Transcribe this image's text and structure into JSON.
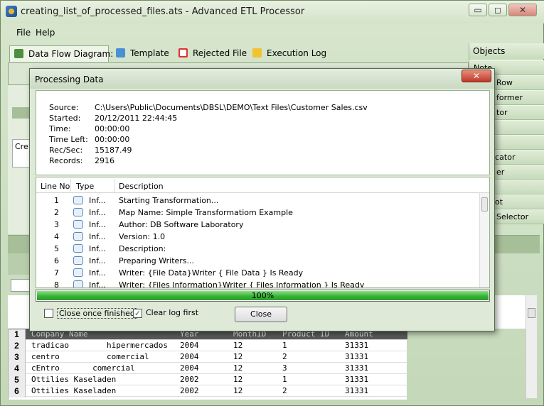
{
  "window": {
    "title": "creating_list_of_processed_files.ats - Advanced ETL Processor",
    "minimize_glyph": "▭",
    "maximize_glyph": "◻",
    "close_glyph": "✕"
  },
  "menu": {
    "file": "File",
    "help": "Help"
  },
  "tabs": [
    {
      "label": "Data Flow Diagram:",
      "icon": "diagram-icon",
      "active": true
    },
    {
      "label": "Template",
      "icon": "template-icon",
      "active": false
    },
    {
      "label": "Rejected File",
      "icon": "rejected-icon",
      "active": false
    },
    {
      "label": "Execution Log",
      "icon": "log-icon",
      "active": false
    }
  ],
  "objects_panel": {
    "header": "Objects",
    "items": [
      "Note",
      "Row",
      "former",
      "tor",
      "",
      "",
      "licator",
      "er",
      "",
      "ot",
      "Selector"
    ]
  },
  "left_fragments": {
    "cre": "Cre"
  },
  "dialog": {
    "title": "Processing Data",
    "close_glyph": "✕",
    "info": {
      "source_label": "Source:",
      "source_value": "C:\\Users\\Public\\Documents\\DBSL\\DEMO\\Text Files\\Customer  Sales.csv",
      "started_label": "Started:",
      "started_value": "20/12/2011 22:44:45",
      "time_label": "Time:",
      "time_value": "00:00:00",
      "time_left_label": "Time Left:",
      "time_left_value": "00:00:00",
      "rec_sec_label": "Rec/Sec:",
      "rec_sec_value": "15187.49",
      "records_label": "Records:",
      "records_value": "2916"
    },
    "log": {
      "columns": [
        "Line No",
        "Type",
        "Description"
      ],
      "rows": [
        {
          "no": "1",
          "type": "Inf...",
          "desc": "Starting Transformation..."
        },
        {
          "no": "2",
          "type": "Inf...",
          "desc": "Map Name: Simple Transformatiom Example"
        },
        {
          "no": "3",
          "type": "Inf...",
          "desc": "Author: DB Software Laboratory"
        },
        {
          "no": "4",
          "type": "Inf...",
          "desc": "Version: 1.0"
        },
        {
          "no": "5",
          "type": "Inf...",
          "desc": "Description:"
        },
        {
          "no": "6",
          "type": "Inf...",
          "desc": "Preparing Writers..."
        },
        {
          "no": "7",
          "type": "Inf...",
          "desc": "Writer: {File Data}Writer { File Data } Is Ready"
        },
        {
          "no": "8",
          "type": "Inf...",
          "desc": "Writer: {Files Information}Writer { Files Information } Is Ready"
        }
      ]
    },
    "progress": {
      "value": 1.0,
      "label": "100%"
    },
    "close_once_finished": {
      "label": "Close once finished",
      "checked": false
    },
    "clear_log_first": {
      "label": "Clear log first",
      "checked": true
    },
    "close_button": "Close"
  },
  "grid": {
    "columns": [
      "Company Name",
      "Year",
      "MonthID",
      "Product ID",
      "Amount"
    ],
    "rows": [
      {
        "no": "1",
        "cells": [
          "Company Name",
          "Year",
          "MonthID",
          "Product ID",
          "Amount"
        ],
        "header": true
      },
      {
        "no": "2",
        "cells": [
          "tradicao        hipermercados",
          "2004",
          "12",
          "1",
          "31331"
        ]
      },
      {
        "no": "3",
        "cells": [
          "centro          comercial",
          "2004",
          "12",
          "2",
          "31331"
        ]
      },
      {
        "no": "4",
        "cells": [
          "cEntro       comercial",
          "2004",
          "12",
          "3",
          "31331"
        ]
      },
      {
        "no": "5",
        "cells": [
          "Ottilies Kaseladen",
          "2002",
          "12",
          "1",
          "31331"
        ]
      },
      {
        "no": "6",
        "cells": [
          "Ottilies Kaseladen",
          "2002",
          "12",
          "2",
          "31331"
        ]
      }
    ]
  }
}
